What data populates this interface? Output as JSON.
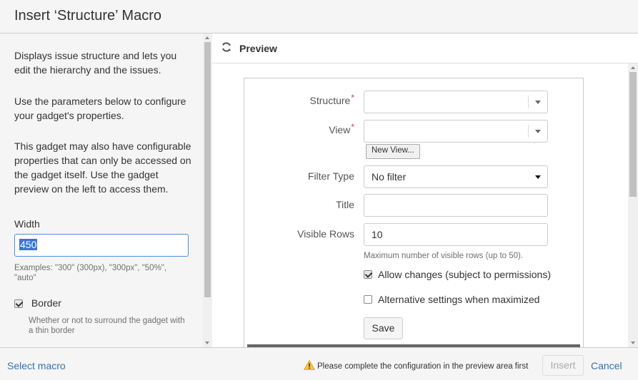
{
  "dialog": {
    "title": "Insert ‘Structure’ Macro"
  },
  "left": {
    "description": [
      "Displays issue structure and lets you edit the hierarchy and the issues.",
      "Use the parameters below to configure your gadget's properties.",
      "This gadget may also have configurable properties that can only be accessed on the gadget itself. Use the gadget preview on the left to access them."
    ],
    "width_label": "Width",
    "width_value": "450",
    "width_help": "Examples: \"300\" (300px), \"300px\", \"50%\", \"auto\"",
    "border_label": "Border",
    "border_checked": true,
    "border_help": "Whether or not to surround the gadget with a thin border"
  },
  "preview": {
    "title": "Preview",
    "form": {
      "structure_label": "Structure",
      "required_mark": "*",
      "view_label": "View",
      "new_view_button": "New View...",
      "filter_type_label": "Filter Type",
      "filter_type_value": "No filter",
      "title_label": "Title",
      "title_value": "",
      "visible_rows_label": "Visible Rows",
      "visible_rows_value": "10",
      "visible_rows_hint": "Maximum number of visible rows (up to 50).",
      "allow_changes_label": "Allow changes (subject to permissions)",
      "allow_changes_checked": true,
      "alt_settings_label": "Alternative settings when maximized",
      "alt_settings_checked": false,
      "save_button": "Save"
    }
  },
  "footer": {
    "select_macro": "Select macro",
    "warning": "Please complete the configuration in the preview area first",
    "insert_button": "Insert",
    "cancel_button": "Cancel"
  },
  "colors": {
    "link": "#3572b0",
    "required": "#d04437",
    "warning": "#f6c342",
    "focus": "#4a90d9"
  }
}
